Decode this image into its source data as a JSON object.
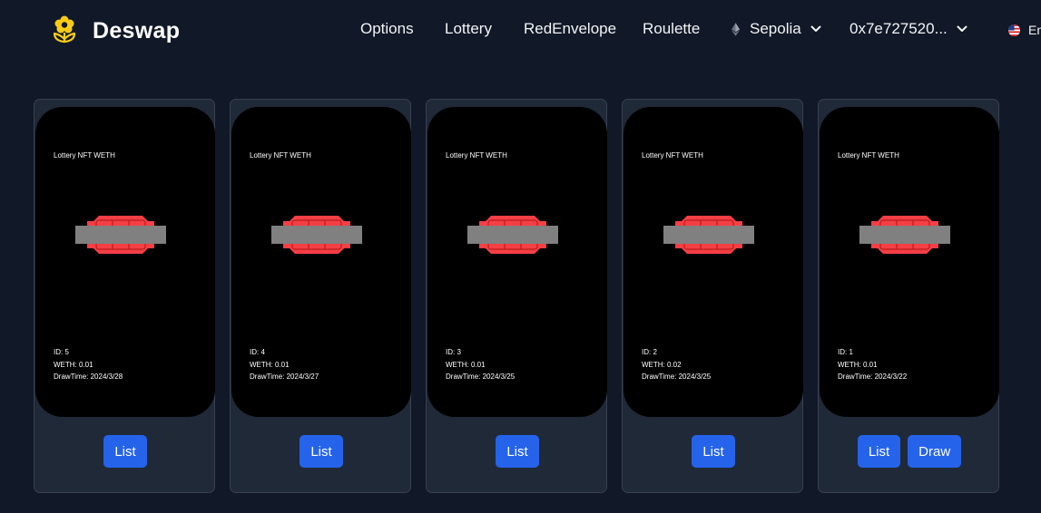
{
  "header": {
    "brand": "Deswap",
    "nav": [
      {
        "label": "Options"
      },
      {
        "label": "Lottery"
      },
      {
        "label": "RedEnvelope"
      },
      {
        "label": "Roulette"
      }
    ],
    "network": {
      "label": "Sepolia",
      "icon": "ethereum-icon"
    },
    "account": {
      "label": "0x7e727520..."
    },
    "language": {
      "label": "En",
      "icon": "us-flag-icon"
    }
  },
  "colors": {
    "background": "#111827",
    "card": "#1f2937",
    "button": "#2563eb",
    "ticket_red": "#f43f45",
    "ticket_bar": "#808080",
    "logo_yellow": "#facc15"
  },
  "cards": [
    {
      "title": "Lottery NFT WETH",
      "id": "ID: 5",
      "weth": "WETH: 0.01",
      "draw_time": "DrawTime: 2024/3/28",
      "list_label": "List"
    },
    {
      "title": "Lottery NFT WETH",
      "id": "ID: 4",
      "weth": "WETH: 0.01",
      "draw_time": "DrawTime: 2024/3/27",
      "list_label": "List"
    },
    {
      "title": "Lottery NFT WETH",
      "id": "ID: 3",
      "weth": "WETH: 0.01",
      "draw_time": "DrawTime: 2024/3/25",
      "list_label": "List"
    },
    {
      "title": "Lottery NFT WETH",
      "id": "ID: 2",
      "weth": "WETH: 0.02",
      "draw_time": "DrawTime: 2024/3/25",
      "list_label": "List"
    },
    {
      "title": "Lottery NFT WETH",
      "id": "ID: 1",
      "weth": "WETH: 0.01",
      "draw_time": "DrawTime: 2024/3/22",
      "list_label": "List",
      "draw_label": "Draw"
    }
  ]
}
